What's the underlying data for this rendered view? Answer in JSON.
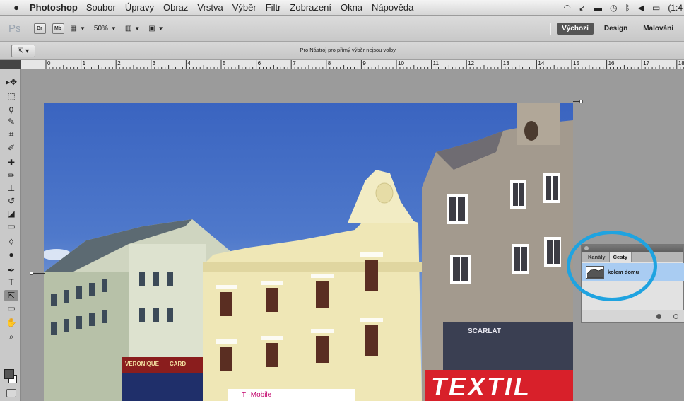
{
  "menubar": {
    "apple_icon": "apple-icon",
    "app_name": "Photoshop",
    "items": [
      "Soubor",
      "Úpravy",
      "Obraz",
      "Vrstva",
      "Výběr",
      "Filtr",
      "Zobrazení",
      "Okna",
      "Nápověda"
    ],
    "status_icons": [
      "wifi-icon",
      "phone-icon",
      "display-icon",
      "timemachine-icon",
      "bluetooth-icon",
      "volume-icon",
      "battery-icon"
    ],
    "battery_text": "(1:4"
  },
  "appbar": {
    "ps_logo": "Ps",
    "bridge_label": "Br",
    "minibridge_label": "Mb",
    "zoom_value": "50%",
    "workspaces": [
      "Výchozí",
      "Design",
      "Malování"
    ],
    "active_workspace": "Výchozí"
  },
  "options": {
    "tool_icon": "direct-selection-arrow-icon",
    "hint": "Pro Nástroj pro přímý výběr nejsou volby."
  },
  "ruler": {
    "labels": [
      "0",
      "1",
      "2",
      "3",
      "4",
      "5",
      "6",
      "7",
      "8",
      "9",
      "10",
      "11",
      "12",
      "13",
      "14",
      "15",
      "16",
      "17",
      "18"
    ]
  },
  "tools": [
    {
      "name": "move-tool-icon",
      "glyph": "▸✥"
    },
    {
      "name": "marquee-tool-icon",
      "glyph": "⬚"
    },
    {
      "name": "lasso-tool-icon",
      "glyph": "ϙ"
    },
    {
      "name": "quick-select-tool-icon",
      "glyph": "✎"
    },
    {
      "name": "crop-tool-icon",
      "glyph": "⌗"
    },
    {
      "name": "eyedropper-tool-icon",
      "glyph": "✐"
    },
    {
      "name": "healing-brush-tool-icon",
      "glyph": "✚"
    },
    {
      "name": "brush-tool-icon",
      "glyph": "✏"
    },
    {
      "name": "clone-stamp-tool-icon",
      "glyph": "⊥"
    },
    {
      "name": "history-brush-tool-icon",
      "glyph": "↺"
    },
    {
      "name": "eraser-tool-icon",
      "glyph": "◪"
    },
    {
      "name": "gradient-tool-icon",
      "glyph": "▭"
    },
    {
      "name": "blur-tool-icon",
      "glyph": "◊"
    },
    {
      "name": "dodge-tool-icon",
      "glyph": "●"
    },
    {
      "name": "pen-tool-icon",
      "glyph": "✒"
    },
    {
      "name": "type-tool-icon",
      "glyph": "T"
    },
    {
      "name": "direct-selection-tool-icon",
      "glyph": "⇱"
    },
    {
      "name": "shape-tool-icon",
      "glyph": "▭"
    },
    {
      "name": "hand-tool-icon",
      "glyph": "✋"
    },
    {
      "name": "zoom-tool-icon",
      "glyph": "⌕"
    }
  ],
  "photo": {
    "banner_text": "TEXTIL",
    "shop_sign_1": "VERONIQUE",
    "shop_sign_2": "CARD",
    "shop_sign_3": "SCARLAT",
    "mobile_sign": "T··Mobile"
  },
  "paths_panel": {
    "tabs": [
      "Kanály",
      "Cesty"
    ],
    "active_tab": "Cesty",
    "paths": [
      {
        "name": "kolem domu"
      }
    ]
  },
  "colors": {
    "highlight_circle": "#1fa3e0",
    "selected_row": "#a9ccf2"
  }
}
